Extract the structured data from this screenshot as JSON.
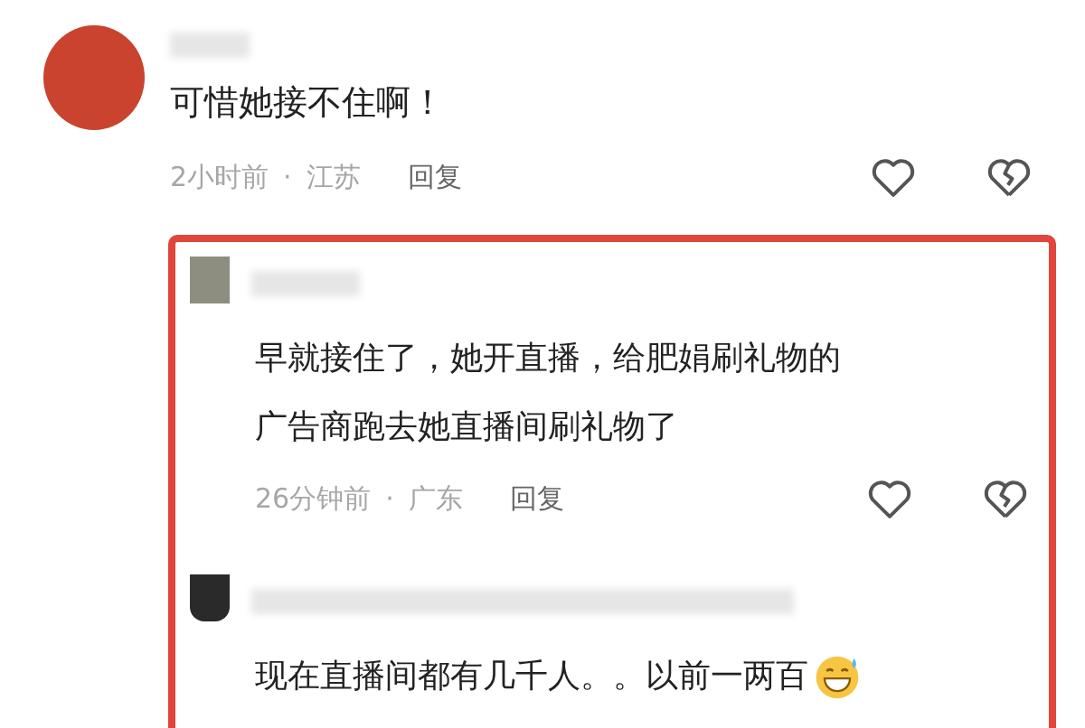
{
  "comment": {
    "text": "可惜她接不住啊！",
    "time": "2小时前",
    "separator": "·",
    "location": "江苏",
    "reply_label": "回复"
  },
  "replies": [
    {
      "lines": [
        "早就接住了，她开直播，给肥娟刷礼物的",
        "广告商跑去她直播间刷礼物了"
      ],
      "emoji": false,
      "time": "26分钟前",
      "separator": "·",
      "location": "广东",
      "reply_label": "回复"
    },
    {
      "lines": [
        "现在直播间都有几千人。。以前一两百"
      ],
      "emoji": true
    }
  ]
}
